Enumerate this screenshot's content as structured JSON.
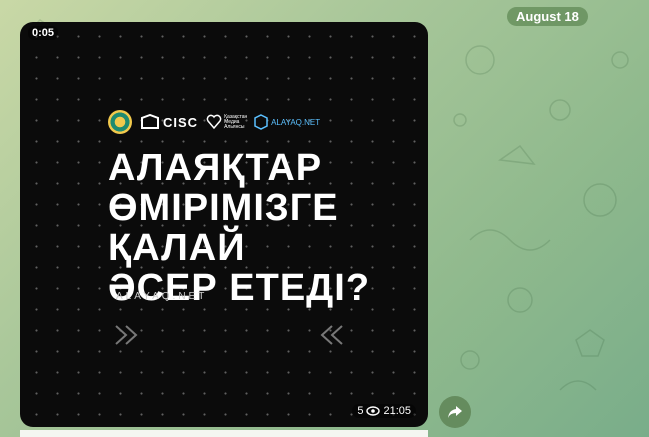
{
  "date_separator": "August 18",
  "video": {
    "duration": "0:05",
    "logos": {
      "cisc": "CISC",
      "small_text": "Қазақстан Медиа Альянсы",
      "alayaq": "ALAYAQ.NET"
    },
    "headline": [
      "АЛАЯҚТАР",
      "ӨМІРІМІЗГЕ",
      "ҚАЛАЙ",
      "ӘСЕР ЕТЕДІ?"
    ],
    "site": "ALAYAQ.NET"
  },
  "message_meta": {
    "views": "5",
    "time": "21:05"
  },
  "icons": {
    "views": "eye-icon",
    "share": "share-icon"
  },
  "colors": {
    "bubble_bg": "#0b0b0b",
    "accent_blue": "#5bc0ff",
    "date_pill": "#608a56"
  }
}
